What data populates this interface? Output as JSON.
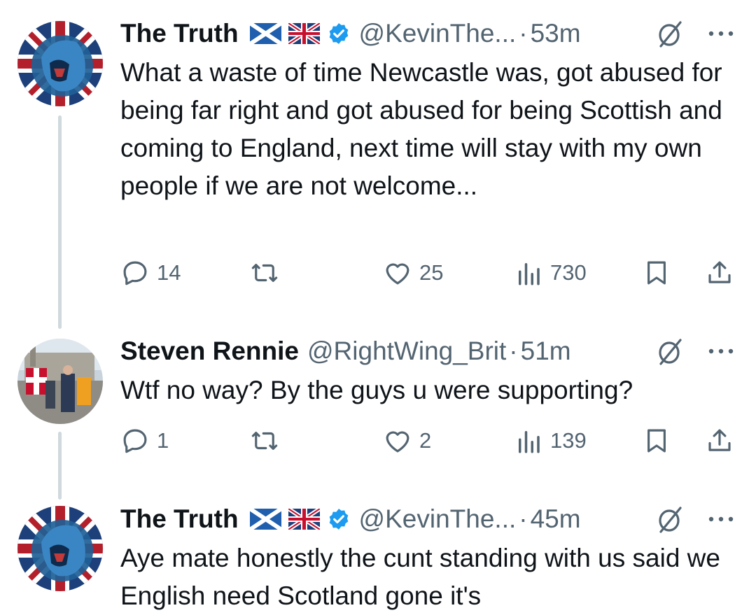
{
  "tweets": [
    {
      "display_name": "The Truth",
      "handle": "@KevinThe...",
      "time": "53m",
      "text": "What a waste of time Newcastle was, got abused for being far right and got abused for being Scottish and coming to England, next time will stay with my own people if we are not welcome...",
      "replies": "14",
      "retweets": "",
      "likes": "25",
      "views": "730"
    },
    {
      "display_name": "Steven Rennie",
      "handle": "@RightWing_Brit",
      "time": "51m",
      "text": "Wtf no way? By the guys u were supporting?",
      "replies": "1",
      "retweets": "",
      "likes": "2",
      "views": "139"
    },
    {
      "display_name": "The Truth",
      "handle": "@KevinThe...",
      "time": "45m",
      "text": "Aye mate honestly the cunt standing with us said we English need Scotland gone it's",
      "replies": "",
      "retweets": "",
      "likes": "",
      "views": ""
    }
  ],
  "separator": "·",
  "icons": {
    "verified": "verified-badge-icon",
    "hidden": "hidden-reply-icon",
    "more": "more-options-icon",
    "reply": "reply-icon",
    "retweet": "retweet-icon",
    "like": "like-icon",
    "views": "views-icon",
    "bookmark": "bookmark-icon",
    "share": "share-icon"
  },
  "colors": {
    "verified_blue": "#1d9bf0",
    "secondary_text": "#536471",
    "thread_line": "#cfd9de"
  }
}
